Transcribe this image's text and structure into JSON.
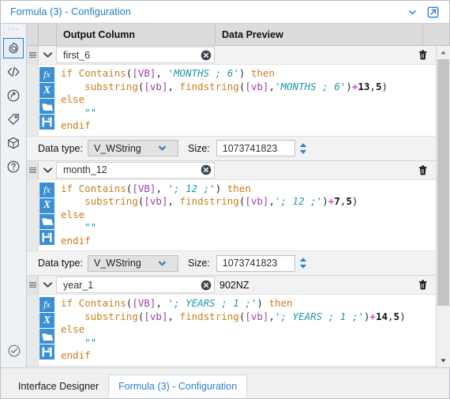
{
  "window": {
    "title": "Formula (3) - Configuration",
    "collapse_icon": "chevron-down-icon",
    "popout_icon": "pop-out-icon"
  },
  "rail": {
    "dots": "···",
    "items": [
      {
        "name": "gear-icon",
        "label": "Configuration",
        "selected": true
      },
      {
        "name": "code-icon",
        "label": "Code",
        "selected": false
      },
      {
        "name": "runtime-icon",
        "label": "Runtime",
        "selected": false
      },
      {
        "name": "tag-icon",
        "label": "Annotation",
        "selected": false
      },
      {
        "name": "package-icon",
        "label": "Package",
        "selected": false
      },
      {
        "name": "help-icon",
        "label": "Help",
        "selected": false
      }
    ],
    "bottom": {
      "name": "check-circle-icon",
      "label": "Valid"
    }
  },
  "grid": {
    "headers": {
      "output_column": "Output Column",
      "data_preview": "Data Preview"
    },
    "delete_icon": "trash-icon",
    "clear_icon": "clear-circle-icon",
    "collapse_icon": "chevron-down-icon",
    "grip_icon": "drag-grip-icon",
    "toolbar_icons": [
      "fx-icon",
      "variable-icon",
      "open-folder-icon",
      "save-icon"
    ],
    "toolbar_glyphs": {
      "fx": "fx",
      "xv": "X"
    }
  },
  "datatype": {
    "label": "Data type:",
    "size_label": "Size:",
    "dropdown_icon": "chevron-down-icon",
    "spinner_icon": "spinner-updown-icon"
  },
  "blocks": [
    {
      "name": "first_6",
      "preview": "",
      "data_type": "V_WString",
      "size": "1073741823",
      "has_datatype_row": true,
      "code": [
        [
          {
            "t": "if ",
            "c": "kw"
          },
          {
            "t": "Contains",
            "c": "fn"
          },
          {
            "t": "(",
            "c": "pl"
          },
          {
            "t": "[VB]",
            "c": "fld"
          },
          {
            "t": ", ",
            "c": "pl"
          },
          {
            "t": "'MONTHS ; 6'",
            "c": "str"
          },
          {
            "t": ") ",
            "c": "pl"
          },
          {
            "t": "then",
            "c": "kw"
          }
        ],
        [
          {
            "t": "    ",
            "c": "pl"
          },
          {
            "t": "substring",
            "c": "fn"
          },
          {
            "t": "(",
            "c": "pl"
          },
          {
            "t": "[vb]",
            "c": "fld"
          },
          {
            "t": ", ",
            "c": "pl"
          },
          {
            "t": "findstring",
            "c": "fn"
          },
          {
            "t": "(",
            "c": "pl"
          },
          {
            "t": "[vb]",
            "c": "fld"
          },
          {
            "t": ",",
            "c": "pl"
          },
          {
            "t": "'MONTHS ; 6'",
            "c": "str"
          },
          {
            "t": ")",
            "c": "pl"
          },
          {
            "t": "+",
            "c": "op"
          },
          {
            "t": "13",
            "c": "num"
          },
          {
            "t": ",",
            "c": "pl"
          },
          {
            "t": "5",
            "c": "num"
          },
          {
            "t": ")",
            "c": "pl"
          }
        ],
        [
          {
            "t": "else",
            "c": "kw"
          }
        ],
        [
          {
            "t": "    ",
            "c": "pl"
          },
          {
            "t": "\"\"",
            "c": "qt"
          }
        ],
        [
          {
            "t": "endif",
            "c": "kw"
          }
        ]
      ]
    },
    {
      "name": "month_12",
      "preview": "",
      "data_type": "V_WString",
      "size": "1073741823",
      "has_datatype_row": true,
      "code": [
        [
          {
            "t": "if ",
            "c": "kw"
          },
          {
            "t": "Contains",
            "c": "fn"
          },
          {
            "t": "(",
            "c": "pl"
          },
          {
            "t": "[VB]",
            "c": "fld"
          },
          {
            "t": ", ",
            "c": "pl"
          },
          {
            "t": "'; 12 ;'",
            "c": "str"
          },
          {
            "t": ") ",
            "c": "pl"
          },
          {
            "t": "then",
            "c": "kw"
          }
        ],
        [
          {
            "t": "    ",
            "c": "pl"
          },
          {
            "t": "substring",
            "c": "fn"
          },
          {
            "t": "(",
            "c": "pl"
          },
          {
            "t": "[vb]",
            "c": "fld"
          },
          {
            "t": ", ",
            "c": "pl"
          },
          {
            "t": "findstring",
            "c": "fn"
          },
          {
            "t": "(",
            "c": "pl"
          },
          {
            "t": "[vb]",
            "c": "fld"
          },
          {
            "t": ",",
            "c": "pl"
          },
          {
            "t": "'; 12 ;'",
            "c": "str"
          },
          {
            "t": ")",
            "c": "pl"
          },
          {
            "t": "+",
            "c": "op"
          },
          {
            "t": "7",
            "c": "num"
          },
          {
            "t": ",",
            "c": "pl"
          },
          {
            "t": "5",
            "c": "num"
          },
          {
            "t": ")",
            "c": "pl"
          }
        ],
        [
          {
            "t": "else",
            "c": "kw"
          }
        ],
        [
          {
            "t": "    ",
            "c": "pl"
          },
          {
            "t": "\"\"",
            "c": "qt"
          }
        ],
        [
          {
            "t": "endif",
            "c": "kw"
          }
        ]
      ]
    },
    {
      "name": "year_1",
      "preview": "902NZ",
      "data_type": "V_WString",
      "size": "1073741823",
      "has_datatype_row": false,
      "code": [
        [
          {
            "t": "if ",
            "c": "kw"
          },
          {
            "t": "Contains",
            "c": "fn"
          },
          {
            "t": "(",
            "c": "pl"
          },
          {
            "t": "[VB]",
            "c": "fld"
          },
          {
            "t": ", ",
            "c": "pl"
          },
          {
            "t": "'; YEARS ; 1 ;'",
            "c": "str"
          },
          {
            "t": ") ",
            "c": "pl"
          },
          {
            "t": "then",
            "c": "kw"
          }
        ],
        [
          {
            "t": "    ",
            "c": "pl"
          },
          {
            "t": "substring",
            "c": "fn"
          },
          {
            "t": "(",
            "c": "pl"
          },
          {
            "t": "[vb]",
            "c": "fld"
          },
          {
            "t": ", ",
            "c": "pl"
          },
          {
            "t": "findstring",
            "c": "fn"
          },
          {
            "t": "(",
            "c": "pl"
          },
          {
            "t": "[vb]",
            "c": "fld"
          },
          {
            "t": ",",
            "c": "pl"
          },
          {
            "t": "'; YEARS ; 1 ;'",
            "c": "str"
          },
          {
            "t": ")",
            "c": "pl"
          },
          {
            "t": "+",
            "c": "op"
          },
          {
            "t": "14",
            "c": "num"
          },
          {
            "t": ",",
            "c": "pl"
          },
          {
            "t": "5",
            "c": "num"
          },
          {
            "t": ")",
            "c": "pl"
          }
        ],
        [
          {
            "t": "else",
            "c": "kw"
          }
        ],
        [
          {
            "t": "    ",
            "c": "pl"
          },
          {
            "t": "\"\"",
            "c": "qt"
          }
        ],
        [
          {
            "t": "endif",
            "c": "kw"
          }
        ]
      ]
    }
  ],
  "scrollbar": {
    "up_icon": "scroll-up-icon",
    "down_icon": "scroll-down-icon"
  },
  "tabs": [
    {
      "label": "Interface Designer",
      "active": false
    },
    {
      "label": "Formula (3) - Configuration",
      "active": true
    }
  ]
}
